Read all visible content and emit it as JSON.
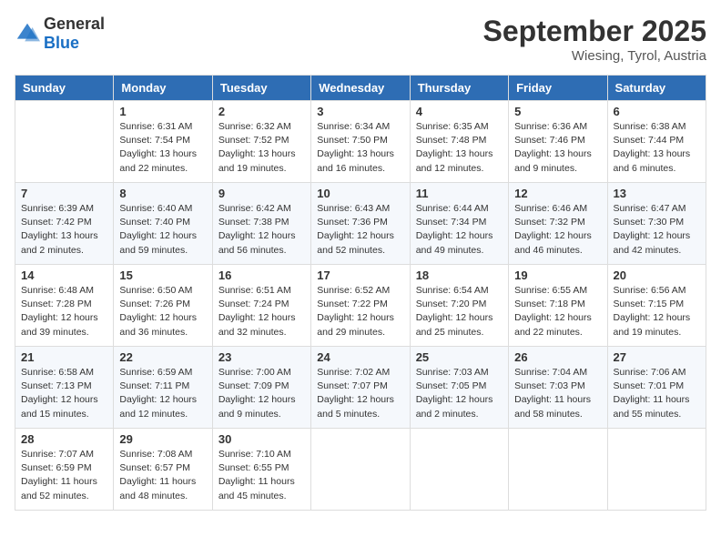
{
  "header": {
    "logo_general": "General",
    "logo_blue": "Blue",
    "month_title": "September 2025",
    "location": "Wiesing, Tyrol, Austria"
  },
  "days_of_week": [
    "Sunday",
    "Monday",
    "Tuesday",
    "Wednesday",
    "Thursday",
    "Friday",
    "Saturday"
  ],
  "weeks": [
    [
      {
        "day": "",
        "info": ""
      },
      {
        "day": "1",
        "info": "Sunrise: 6:31 AM\nSunset: 7:54 PM\nDaylight: 13 hours\nand 22 minutes."
      },
      {
        "day": "2",
        "info": "Sunrise: 6:32 AM\nSunset: 7:52 PM\nDaylight: 13 hours\nand 19 minutes."
      },
      {
        "day": "3",
        "info": "Sunrise: 6:34 AM\nSunset: 7:50 PM\nDaylight: 13 hours\nand 16 minutes."
      },
      {
        "day": "4",
        "info": "Sunrise: 6:35 AM\nSunset: 7:48 PM\nDaylight: 13 hours\nand 12 minutes."
      },
      {
        "day": "5",
        "info": "Sunrise: 6:36 AM\nSunset: 7:46 PM\nDaylight: 13 hours\nand 9 minutes."
      },
      {
        "day": "6",
        "info": "Sunrise: 6:38 AM\nSunset: 7:44 PM\nDaylight: 13 hours\nand 6 minutes."
      }
    ],
    [
      {
        "day": "7",
        "info": "Sunrise: 6:39 AM\nSunset: 7:42 PM\nDaylight: 13 hours\nand 2 minutes."
      },
      {
        "day": "8",
        "info": "Sunrise: 6:40 AM\nSunset: 7:40 PM\nDaylight: 12 hours\nand 59 minutes."
      },
      {
        "day": "9",
        "info": "Sunrise: 6:42 AM\nSunset: 7:38 PM\nDaylight: 12 hours\nand 56 minutes."
      },
      {
        "day": "10",
        "info": "Sunrise: 6:43 AM\nSunset: 7:36 PM\nDaylight: 12 hours\nand 52 minutes."
      },
      {
        "day": "11",
        "info": "Sunrise: 6:44 AM\nSunset: 7:34 PM\nDaylight: 12 hours\nand 49 minutes."
      },
      {
        "day": "12",
        "info": "Sunrise: 6:46 AM\nSunset: 7:32 PM\nDaylight: 12 hours\nand 46 minutes."
      },
      {
        "day": "13",
        "info": "Sunrise: 6:47 AM\nSunset: 7:30 PM\nDaylight: 12 hours\nand 42 minutes."
      }
    ],
    [
      {
        "day": "14",
        "info": "Sunrise: 6:48 AM\nSunset: 7:28 PM\nDaylight: 12 hours\nand 39 minutes."
      },
      {
        "day": "15",
        "info": "Sunrise: 6:50 AM\nSunset: 7:26 PM\nDaylight: 12 hours\nand 36 minutes."
      },
      {
        "day": "16",
        "info": "Sunrise: 6:51 AM\nSunset: 7:24 PM\nDaylight: 12 hours\nand 32 minutes."
      },
      {
        "day": "17",
        "info": "Sunrise: 6:52 AM\nSunset: 7:22 PM\nDaylight: 12 hours\nand 29 minutes."
      },
      {
        "day": "18",
        "info": "Sunrise: 6:54 AM\nSunset: 7:20 PM\nDaylight: 12 hours\nand 25 minutes."
      },
      {
        "day": "19",
        "info": "Sunrise: 6:55 AM\nSunset: 7:18 PM\nDaylight: 12 hours\nand 22 minutes."
      },
      {
        "day": "20",
        "info": "Sunrise: 6:56 AM\nSunset: 7:15 PM\nDaylight: 12 hours\nand 19 minutes."
      }
    ],
    [
      {
        "day": "21",
        "info": "Sunrise: 6:58 AM\nSunset: 7:13 PM\nDaylight: 12 hours\nand 15 minutes."
      },
      {
        "day": "22",
        "info": "Sunrise: 6:59 AM\nSunset: 7:11 PM\nDaylight: 12 hours\nand 12 minutes."
      },
      {
        "day": "23",
        "info": "Sunrise: 7:00 AM\nSunset: 7:09 PM\nDaylight: 12 hours\nand 9 minutes."
      },
      {
        "day": "24",
        "info": "Sunrise: 7:02 AM\nSunset: 7:07 PM\nDaylight: 12 hours\nand 5 minutes."
      },
      {
        "day": "25",
        "info": "Sunrise: 7:03 AM\nSunset: 7:05 PM\nDaylight: 12 hours\nand 2 minutes."
      },
      {
        "day": "26",
        "info": "Sunrise: 7:04 AM\nSunset: 7:03 PM\nDaylight: 11 hours\nand 58 minutes."
      },
      {
        "day": "27",
        "info": "Sunrise: 7:06 AM\nSunset: 7:01 PM\nDaylight: 11 hours\nand 55 minutes."
      }
    ],
    [
      {
        "day": "28",
        "info": "Sunrise: 7:07 AM\nSunset: 6:59 PM\nDaylight: 11 hours\nand 52 minutes."
      },
      {
        "day": "29",
        "info": "Sunrise: 7:08 AM\nSunset: 6:57 PM\nDaylight: 11 hours\nand 48 minutes."
      },
      {
        "day": "30",
        "info": "Sunrise: 7:10 AM\nSunset: 6:55 PM\nDaylight: 11 hours\nand 45 minutes."
      },
      {
        "day": "",
        "info": ""
      },
      {
        "day": "",
        "info": ""
      },
      {
        "day": "",
        "info": ""
      },
      {
        "day": "",
        "info": ""
      }
    ]
  ]
}
